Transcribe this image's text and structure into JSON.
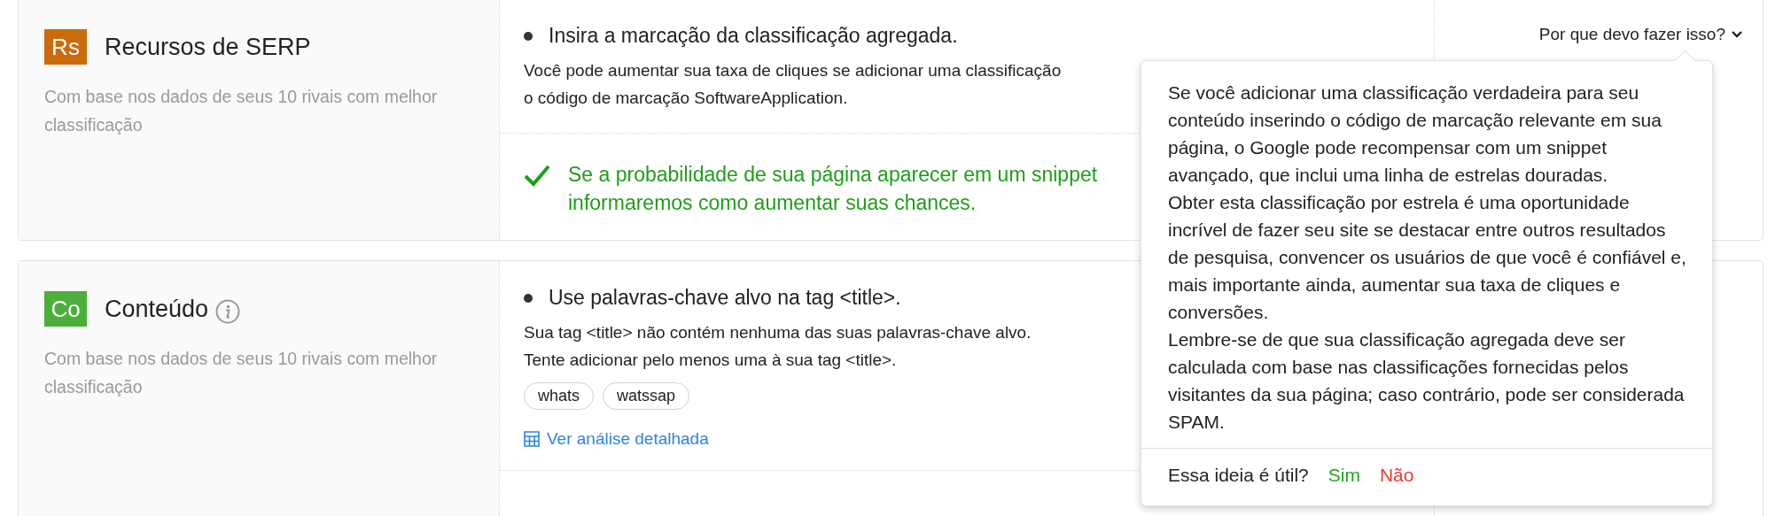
{
  "sections": [
    {
      "badge": "Rs",
      "color": "#cc6a0e",
      "title": "Recursos de SERP",
      "info": false,
      "subtitle": "Com base nos dados de seus 10 rivais com melhor classificação",
      "items": [
        {
          "kind": "recommendation",
          "heading": "Insira a marcação da classificação agregada.",
          "body_lines": [
            "Você pode aumentar sua taxa de cliques se adicionar uma classificação",
            "o código de marcação SoftwareApplication."
          ],
          "action": "Por que devo fazer isso?",
          "expanded": true
        },
        {
          "kind": "success",
          "lines": [
            "Se a probabilidade de sua página aparecer em um snippet",
            "informaremos como aumentar suas chances."
          ]
        }
      ]
    },
    {
      "badge": "Co",
      "color": "#4cae3b",
      "title": "Conteúdo",
      "info": true,
      "subtitle": "Com base nos dados de seus 10 rivais com melhor classificação",
      "items": [
        {
          "kind": "recommendation",
          "heading": "Use palavras-chave alvo na tag <title>.",
          "body_lines": [
            "Sua tag <title> não contém nenhuma das suas palavras-chave alvo.",
            "Tente adicionar pelo menos uma à sua tag <title>."
          ],
          "tags": [
            "whats",
            "watssap"
          ],
          "link": "Ver análise detalhada"
        }
      ]
    }
  ],
  "popup": {
    "paragraphs": [
      "Se você adicionar uma classificação verdadeira para seu conteúdo inserindo o código de marcação relevante em sua página, o Google pode recompensar com um snippet avançado, que inclui uma linha de estrelas douradas.",
      "Obter esta classificação por estrela é uma oportunidade incrível de fazer seu site se destacar entre outros resultados de pesquisa, convencer os usuários de que você é confiável e, mais importante ainda, aumentar sua taxa de cliques e conversões.",
      "Lembre-se de que sua classificação agregada deve ser calculada com base nas classificações fornecidas pelos visitantes da sua página; caso contrário, pode ser considerada SPAM."
    ],
    "question": "Essa ideia é útil?",
    "yes": "Sim",
    "no": "Não"
  }
}
